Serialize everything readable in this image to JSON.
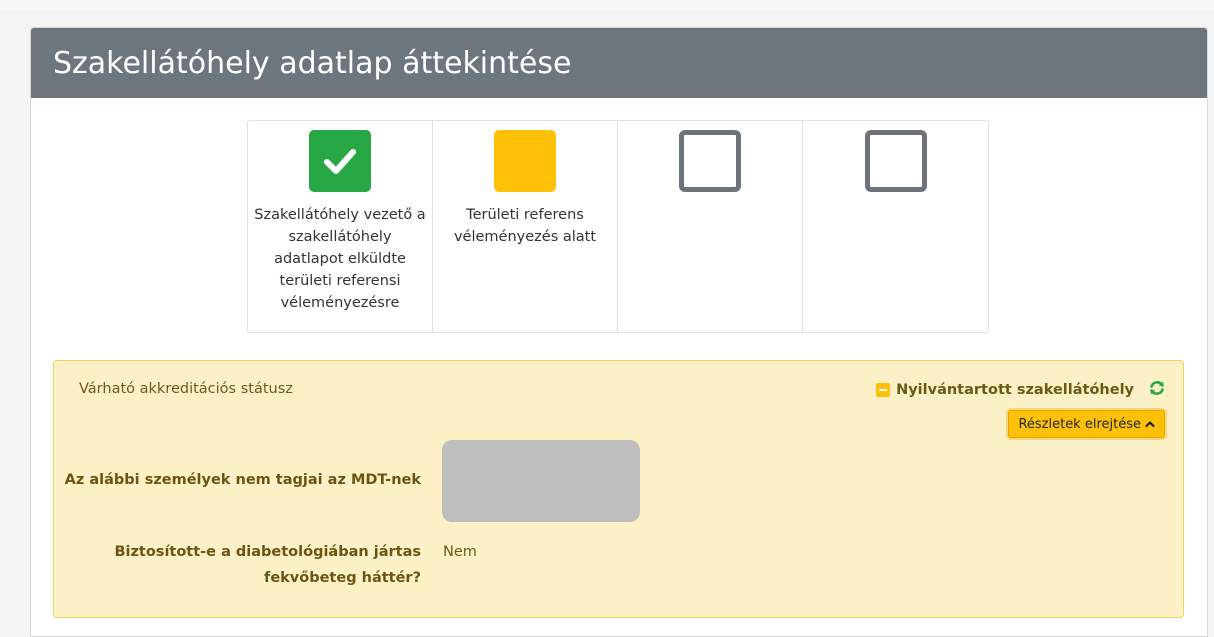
{
  "card": {
    "title": "Szakellátóhely adatlap áttekintése"
  },
  "steps": [
    {
      "state": "done",
      "icon": "check-icon",
      "text": "Szakellátóhely vezető a szakellátóhely adatlapot elküldte területi referensi véleményezésre"
    },
    {
      "state": "pending",
      "icon": "pending-square-icon",
      "text": "Területi referens véleményezés alatt"
    },
    {
      "state": "empty",
      "icon": "empty-square-icon",
      "text": ""
    },
    {
      "state": "empty",
      "icon": "empty-square-icon",
      "text": ""
    }
  ],
  "status": {
    "label": "Várható akkreditációs státusz",
    "value": "Nyilvántartott szakellátóhely",
    "toggle_label": "Részletek elrejtése",
    "rows": [
      {
        "label": "Az alábbi személyek nem tagjai az MDT-nek",
        "value": ""
      },
      {
        "label": "Biztosított-e a diabetológiában jártas fekvőbeteg háttér?",
        "value": "Nem"
      }
    ]
  },
  "colors": {
    "header": "#6d757d",
    "done": "#28a745",
    "pending": "#ffc107",
    "empty_border": "#6c737a",
    "status_bg": "#fcf0c6"
  }
}
